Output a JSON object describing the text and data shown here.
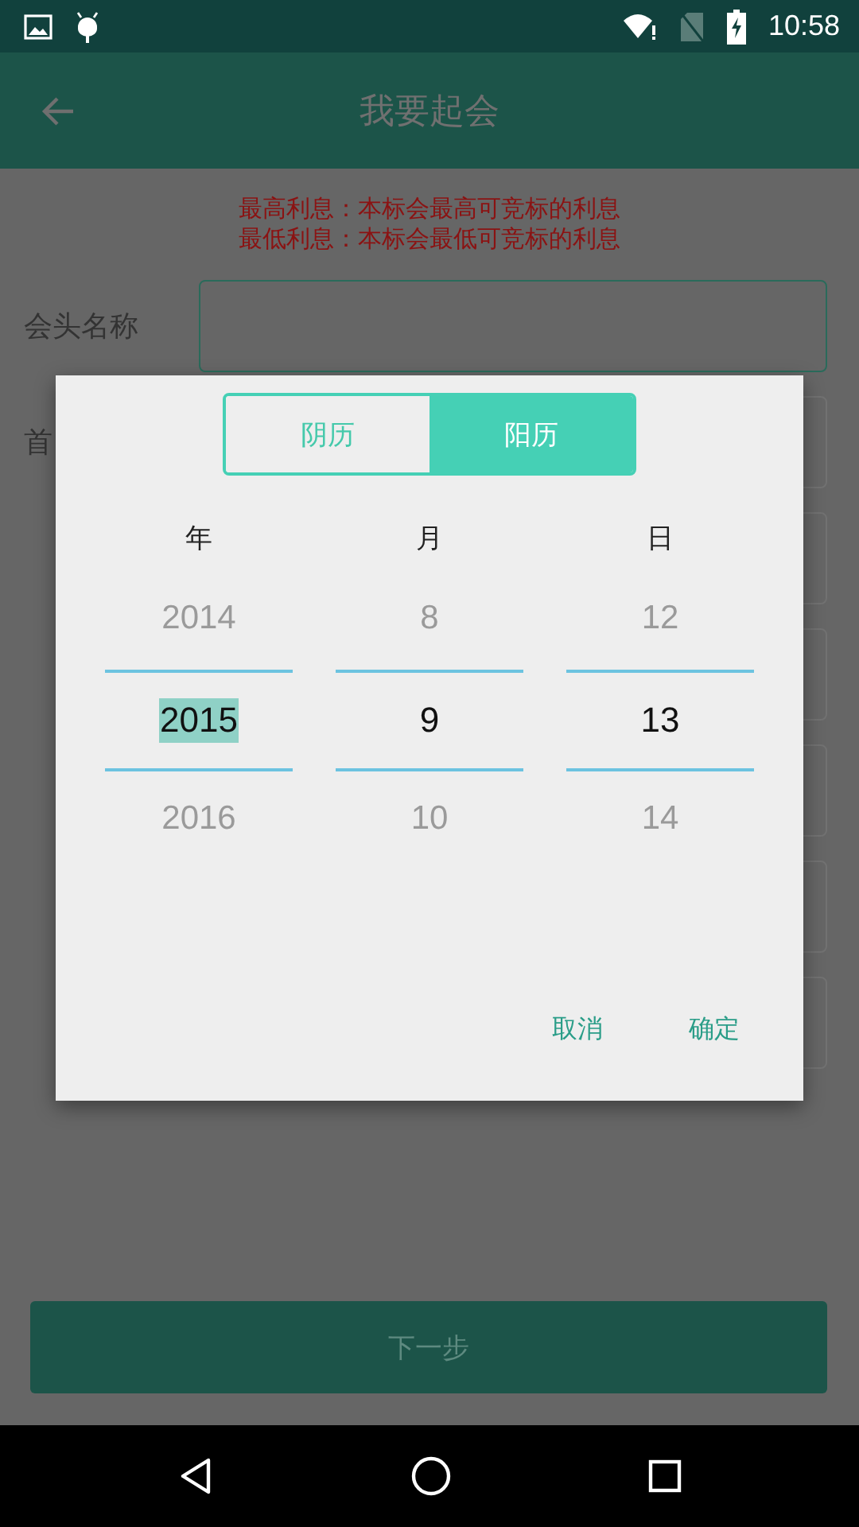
{
  "status_bar": {
    "time": "10:58"
  },
  "app_bar": {
    "title": "我要起会"
  },
  "notice": [
    "最高利息：本标会最高可竞标的利息",
    "最低利息：本标会最低可竞标的利息"
  ],
  "form_rows": [
    {
      "label": "会头名称",
      "focused": true
    },
    {
      "label": "首"
    },
    {},
    {},
    {},
    {},
    {}
  ],
  "next_button": "下一步",
  "dialog": {
    "tabs": [
      {
        "label": "阴历",
        "selected": false
      },
      {
        "label": "阳历",
        "selected": true
      }
    ],
    "columns": [
      {
        "header": "年",
        "prev": "2014",
        "value": "2015",
        "next": "2016",
        "highlighted": true
      },
      {
        "header": "月",
        "prev": "8",
        "value": "9",
        "next": "10",
        "highlighted": false
      },
      {
        "header": "日",
        "prev": "12",
        "value": "13",
        "next": "14",
        "highlighted": false
      }
    ],
    "buttons": [
      "取消",
      "确定"
    ]
  }
}
